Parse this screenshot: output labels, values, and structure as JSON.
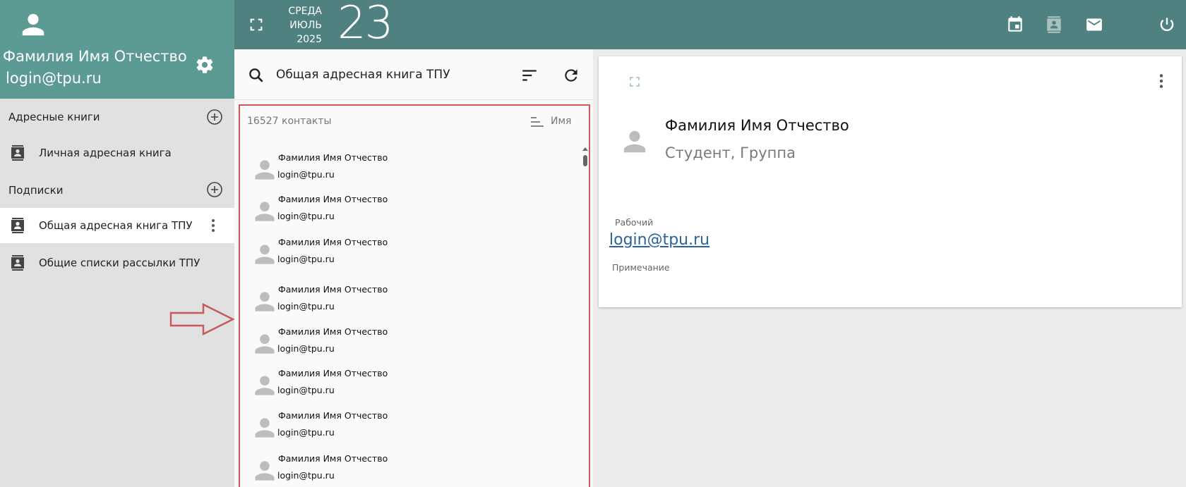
{
  "user": {
    "name": "Фамилия Имя Отчество",
    "login": "login@tpu.ru"
  },
  "date": {
    "weekday": "СРЕДА",
    "month": "ИЮЛЬ",
    "year": "2025",
    "day": "23"
  },
  "sidebar": {
    "address_books_title": "Адресные книги",
    "subscriptions_title": "Подписки",
    "items": [
      {
        "label": "Личная адресная книга",
        "active": false
      },
      {
        "label": "Общая адресная книга ТПУ",
        "active": true
      },
      {
        "label": "Общие списки рассылки ТПУ",
        "active": false
      }
    ]
  },
  "list_header": {
    "title": "Общая адресная книга ТПУ"
  },
  "contacts": {
    "count_text": "16527 контакты",
    "sort_label": "Имя",
    "items": [
      {
        "name": "Фамилия Имя Отчество",
        "email": "login@tpu.ru"
      },
      {
        "name": "Фамилия Имя Отчество",
        "email": "login@tpu.ru"
      },
      {
        "name": "Фамилия Имя Отчество",
        "email": "login@tpu.ru"
      },
      {
        "name": "Фамилия Имя Отчество",
        "email": "login@tpu.ru"
      },
      {
        "name": "Фамилия Имя Отчество",
        "email": "login@tpu.ru"
      },
      {
        "name": "Фамилия Имя Отчество",
        "email": "login@tpu.ru"
      },
      {
        "name": "Фамилия Имя Отчество",
        "email": "login@tpu.ru"
      },
      {
        "name": "Фамилия Имя Отчество",
        "email": "login@tpu.ru"
      }
    ]
  },
  "detail": {
    "name": "Фамилия Имя Отчество",
    "role": "Студент, Группа",
    "work_label": "Рабочий",
    "work_email": "login@tpu.ru",
    "note_label": "Примечание"
  },
  "colors": {
    "sidebar_header": "#5c9a94",
    "topbar": "#4e8180",
    "annotation_red": "#c8585a",
    "link_blue": "#2a6496"
  },
  "icons": [
    "user-icon",
    "gear-icon",
    "plus-circle-icon",
    "address-book-icon",
    "more-vertical-icon",
    "fullscreen-icon",
    "calendar-icon",
    "contacts-icon",
    "mail-icon",
    "power-icon",
    "search-icon",
    "sort-icon",
    "refresh-icon",
    "sort-name-icon",
    "arrow-right-icon"
  ]
}
